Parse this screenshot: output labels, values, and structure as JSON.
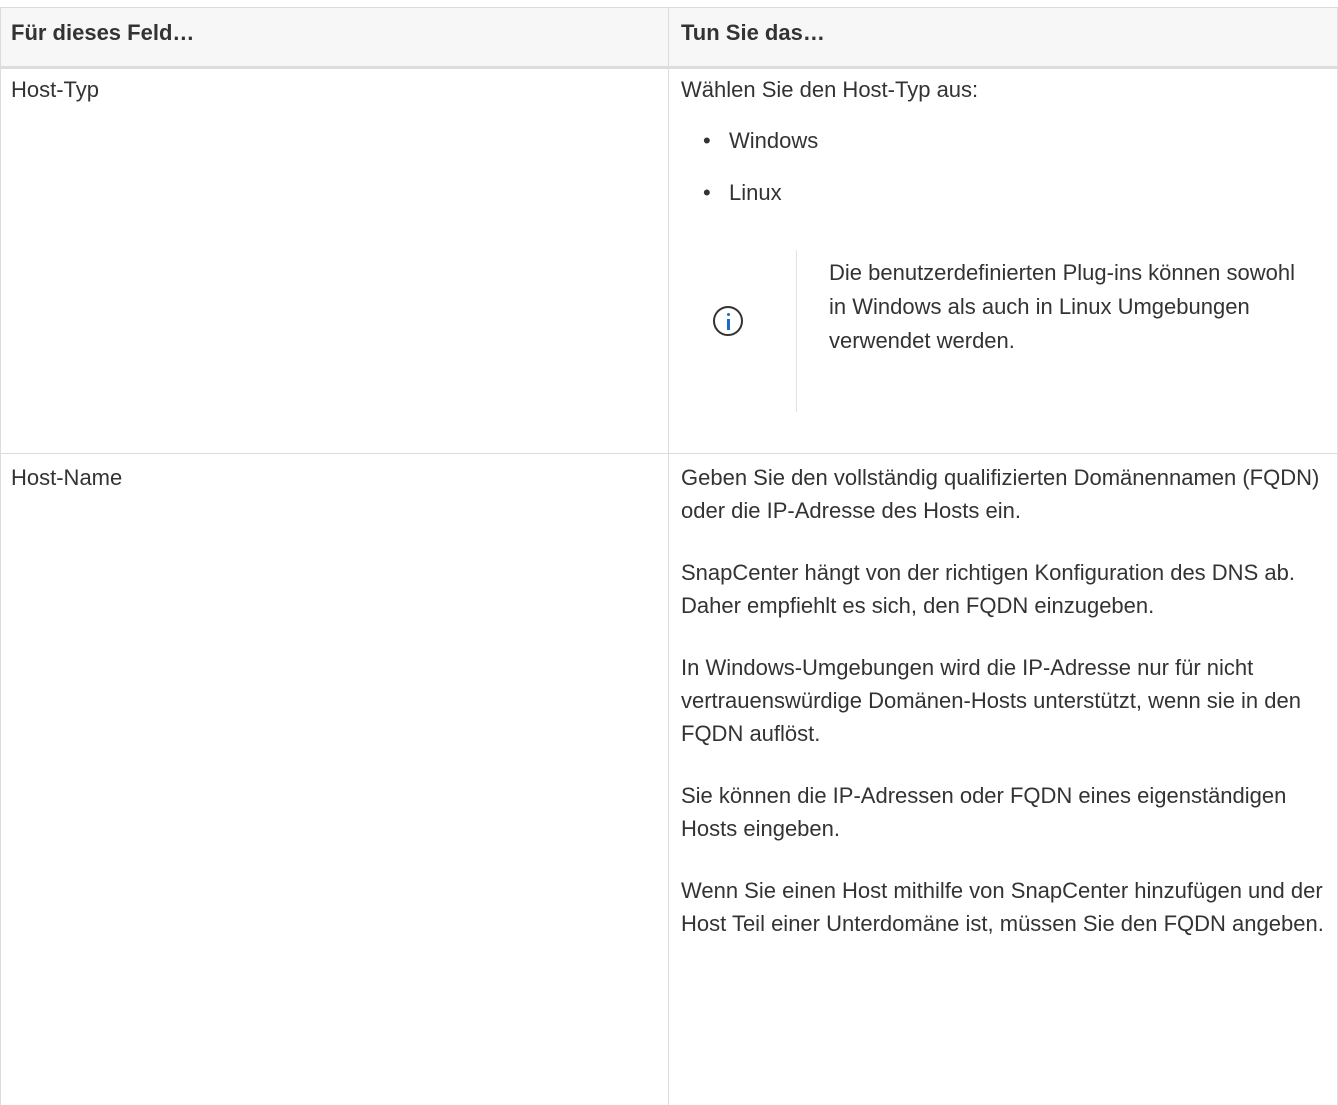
{
  "table": {
    "headers": {
      "field": "Für dieses Feld…",
      "action": "Tun Sie das…"
    },
    "rows": [
      {
        "field": "Host-Typ",
        "intro": "Wählen Sie den Host-Typ aus:",
        "options": [
          "Windows",
          "Linux"
        ],
        "note": {
          "icon": "info-icon",
          "text": "Die benutzerdefinierten Plug-ins können sowohl in Windows als auch in Linux Umgebungen verwendet werden."
        }
      },
      {
        "field": "Host-Name",
        "paragraphs": [
          "Geben Sie den vollständig qualifizierten Domänennamen (FQDN) oder die IP-Adresse des Hosts ein.",
          "SnapCenter hängt von der richtigen Konfiguration des DNS ab. Daher empfiehlt es sich, den FQDN einzugeben.",
          "In Windows-Umgebungen wird die IP-Adresse nur für nicht vertrauenswürdige Domänen-Hosts unterstützt, wenn sie in den FQDN auflöst.",
          "Sie können die IP-Adressen oder FQDN eines eigenständigen Hosts eingeben.",
          "Wenn Sie einen Host mithilfe von SnapCenter hinzufügen und der Host Teil einer Unterdomäne ist, müssen Sie den FQDN angeben."
        ]
      }
    ]
  },
  "colors": {
    "text": "#333333",
    "header_bg": "#f7f7f7",
    "border": "#dcdcdc",
    "info_icon": "#1a6bc6"
  }
}
